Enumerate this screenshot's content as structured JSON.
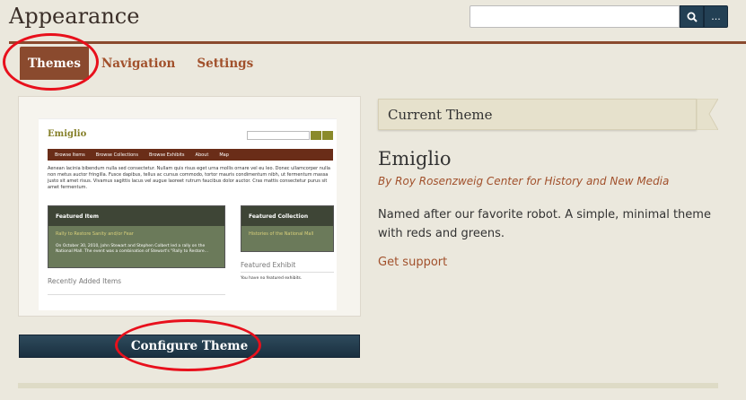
{
  "header": {
    "title": "Appearance",
    "search_placeholder": "",
    "more_label": "..."
  },
  "tabs": [
    {
      "label": "Themes",
      "active": true
    },
    {
      "label": "Navigation",
      "active": false
    },
    {
      "label": "Settings",
      "active": false
    }
  ],
  "preview": {
    "site_title": "Emiglio",
    "nav": [
      "Browse Items",
      "Browse Collections",
      "Browse Exhibits",
      "About",
      "Map"
    ],
    "intro_text": "Aenean lacinia bibendum nulla sed consectetur. Nullam quis risus eget urna mollis ornare vel eu leo. Donec ullamcorper nulla non metus auctor fringilla. Fusce dapibus, tellus ac cursus commodo, tortor mauris condimentum nibh, ut fermentum massa justo sit amet risus. Vivamus sagittis lacus vel augue laoreet rutrum faucibus dolor auctor. Cras mattis consectetur purus sit amet fermentum.",
    "featured_item_heading": "Featured Item",
    "featured_item_link": "Rally to Restore Sanity and/or Fear",
    "featured_item_text": "On October 30, 2010, John Stewart and Stephen Colbert led a rally on the National Mall. The event was a combination of Stewart's \"Rally to Restore...",
    "featured_collection_heading": "Featured Collection",
    "featured_collection_link": "Histories of the National Mall",
    "featured_exhibit_heading": "Featured Exhibit",
    "featured_exhibit_text": "You have no featured exhibits.",
    "recent_heading": "Recently Added Items"
  },
  "configure_button": "Configure Theme",
  "current_theme": {
    "banner": "Current Theme",
    "name": "Emiglio",
    "author": "By Roy Rosenzweig Center for History and New Media",
    "description": "Named after our favorite robot. A simple, minimal theme with reds and greens.",
    "support_link": "Get support"
  },
  "colors": {
    "accent": "#a1502b",
    "tab_active_bg": "#8a4a2e",
    "button_bg": "#234054",
    "highlight": "#e8101c"
  },
  "icons": {
    "search": "search-icon",
    "more": "more-icon"
  }
}
